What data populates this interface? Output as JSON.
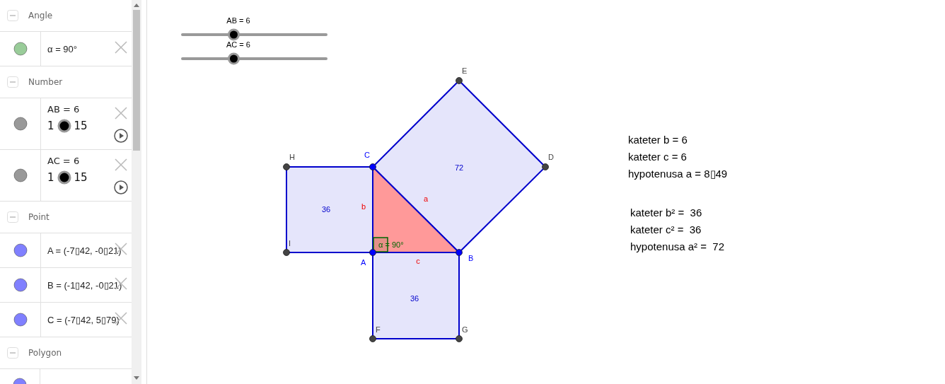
{
  "algebra": {
    "groups": [
      {
        "title": "Angle",
        "expanded": true,
        "items": [
          {
            "kind": "value",
            "text": "α = 90°",
            "color": "#99cc99"
          }
        ]
      },
      {
        "title": "Number",
        "expanded": true,
        "items": [
          {
            "kind": "slider",
            "text": "AB = 6",
            "min": "1",
            "max": "15",
            "color": "#999999"
          },
          {
            "kind": "slider",
            "text": "AC = 6",
            "min": "1",
            "max": "15",
            "color": "#999999"
          }
        ]
      },
      {
        "title": "Point",
        "expanded": true,
        "items": [
          {
            "kind": "value",
            "text": "A = (-7▯42, -0▯21)",
            "color": "#8080ff"
          },
          {
            "kind": "value",
            "text": "B = (-1▯42, -0▯21)",
            "color": "#8080ff"
          },
          {
            "kind": "value",
            "text": "C = (-7▯42, 5▯79)",
            "color": "#8080ff"
          }
        ]
      },
      {
        "title": "Polygon",
        "expanded": true,
        "items": [
          {
            "kind": "partial",
            "color": "#8080ff"
          }
        ]
      }
    ]
  },
  "canvas": {
    "sliders": [
      {
        "label": "AB = 6",
        "level": 0.357
      },
      {
        "label": "AC = 6",
        "level": 0.357
      }
    ],
    "points": [
      {
        "label": "A",
        "color": "#0000ff"
      },
      {
        "label": "B",
        "color": "#0000ff"
      },
      {
        "label": "C",
        "color": "#0000ff"
      },
      {
        "label": "D",
        "color": "#444444"
      },
      {
        "label": "E",
        "color": "#444444"
      },
      {
        "label": "F",
        "color": "#444444"
      },
      {
        "label": "G",
        "color": "#444444"
      },
      {
        "label": "H",
        "color": "#444444"
      },
      {
        "label": "I",
        "color": "#444444"
      }
    ],
    "areas": [
      "72",
      "36",
      "36"
    ],
    "sides": [
      "a",
      "b",
      "c"
    ],
    "angle": "α = 90°",
    "notes": [
      "kateter b = 6",
      "kateter c = 6",
      "hypotenusa a = 8▯49",
      "kateter b² =  36",
      "kateter c² =  36",
      "hypotenusa a² =  72"
    ]
  }
}
